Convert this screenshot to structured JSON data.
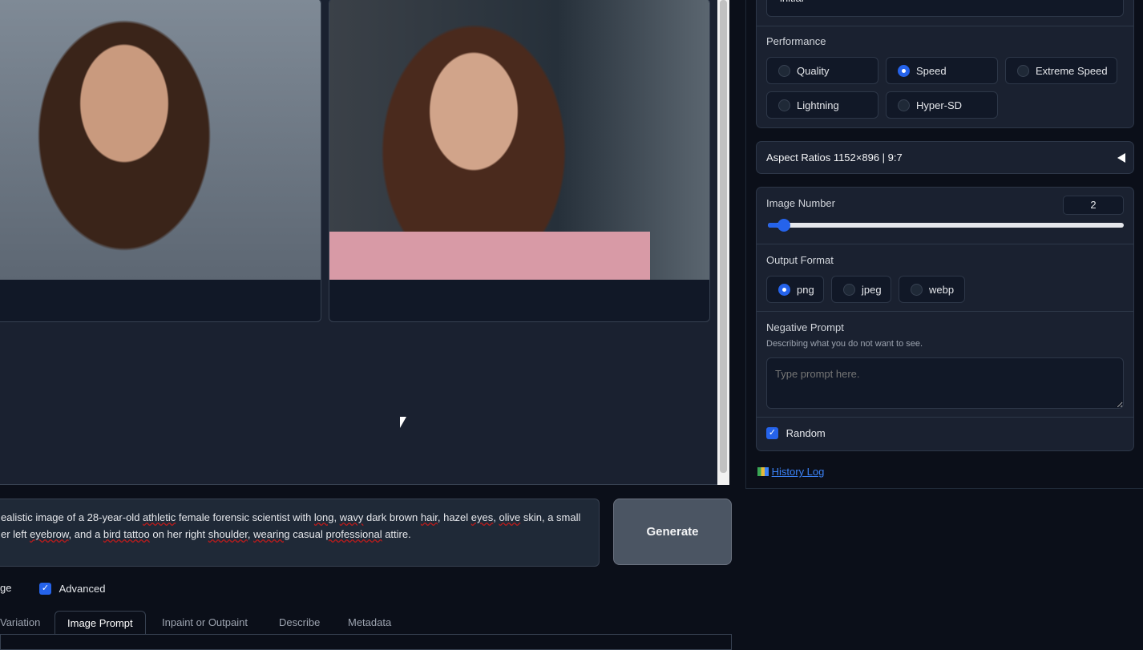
{
  "gallery": {
    "images": [
      "generated-image-1",
      "generated-image-2"
    ]
  },
  "prompt": {
    "line1": [
      "ealistic image of a 28-year-old ",
      "athletic",
      " female forensic scientist with ",
      "long",
      ", ",
      "wavy",
      " dark brown ",
      "hair",
      ", hazel ",
      "eyes",
      ", ",
      "olive",
      " skin, a small"
    ],
    "line2": [
      "er left ",
      "eyebrow",
      ", and a ",
      "bird tattoo",
      " on her right ",
      "shoulder",
      ", ",
      "wearing",
      " casual ",
      "professional",
      " attire."
    ]
  },
  "generate_label": "Generate",
  "options": {
    "image_partial": "ge",
    "advanced": "Advanced"
  },
  "tabs": [
    "Variation",
    "Image Prompt",
    "Inpaint or Outpaint",
    "Describe",
    "Metadata"
  ],
  "right": {
    "preset_value": "initial",
    "performance": {
      "label": "Performance",
      "options": [
        "Quality",
        "Speed",
        "Extreme Speed",
        "Lightning",
        "Hyper-SD"
      ],
      "selected": "Speed"
    },
    "aspect": {
      "label": "Aspect Ratios 1152×896 | 9:7"
    },
    "image_number": {
      "label": "Image Number",
      "value": "2",
      "min": 1,
      "max": 32
    },
    "output_format": {
      "label": "Output Format",
      "options": [
        "png",
        "jpeg",
        "webp"
      ],
      "selected": "png"
    },
    "negative": {
      "label": "Negative Prompt",
      "hint": "Describing what you do not want to see.",
      "placeholder": "Type prompt here."
    },
    "random": "Random",
    "history": "History Log"
  },
  "colors": {
    "accent": "#2563eb",
    "background": "#0b0f19"
  }
}
